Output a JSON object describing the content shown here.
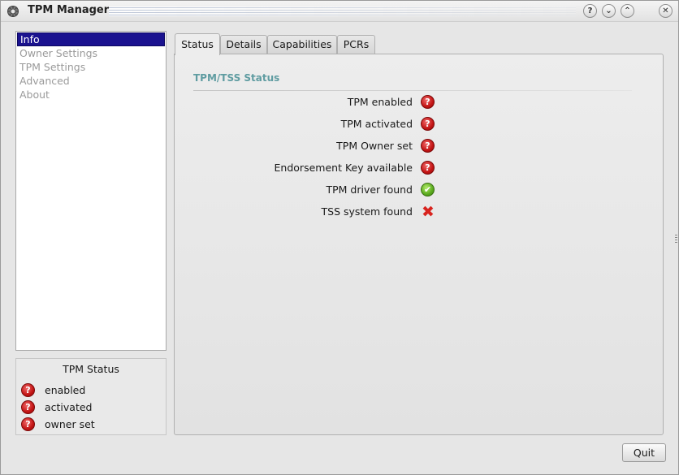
{
  "window": {
    "title": "TPM Manager",
    "buttons": [
      "?",
      "⌄",
      "⌃",
      "✕"
    ]
  },
  "sidebar": {
    "items": [
      {
        "label": "Info",
        "selected": true
      },
      {
        "label": "Owner Settings",
        "selected": false
      },
      {
        "label": "TPM Settings",
        "selected": false
      },
      {
        "label": "Advanced",
        "selected": false
      },
      {
        "label": "About",
        "selected": false
      }
    ]
  },
  "status_box": {
    "title": "TPM Status",
    "rows": [
      {
        "label": "enabled",
        "icon": "question-icon"
      },
      {
        "label": "activated",
        "icon": "question-icon"
      },
      {
        "label": "owner set",
        "icon": "question-icon"
      }
    ]
  },
  "tabs": [
    {
      "label": "Status",
      "active": true
    },
    {
      "label": "Details",
      "active": false
    },
    {
      "label": "Capabilities",
      "active": false
    },
    {
      "label": "PCRs",
      "active": false
    }
  ],
  "status_panel": {
    "group_title": "TPM/TSS Status",
    "rows": [
      {
        "label": "TPM enabled",
        "icon": "question-icon"
      },
      {
        "label": "TPM activated",
        "icon": "question-icon"
      },
      {
        "label": "TPM Owner set",
        "icon": "question-icon"
      },
      {
        "label": "Endorsement Key available",
        "icon": "question-icon"
      },
      {
        "label": "TPM driver found",
        "icon": "check-icon"
      },
      {
        "label": "TSS system found",
        "icon": "cross-icon"
      }
    ]
  },
  "footer": {
    "quit_label": "Quit"
  },
  "colors": {
    "selection": "#1a128f",
    "group_title": "#5f9ca1",
    "question_red": "#c31414",
    "check_green": "#5aaa1e",
    "cross_red": "#d8241f"
  }
}
